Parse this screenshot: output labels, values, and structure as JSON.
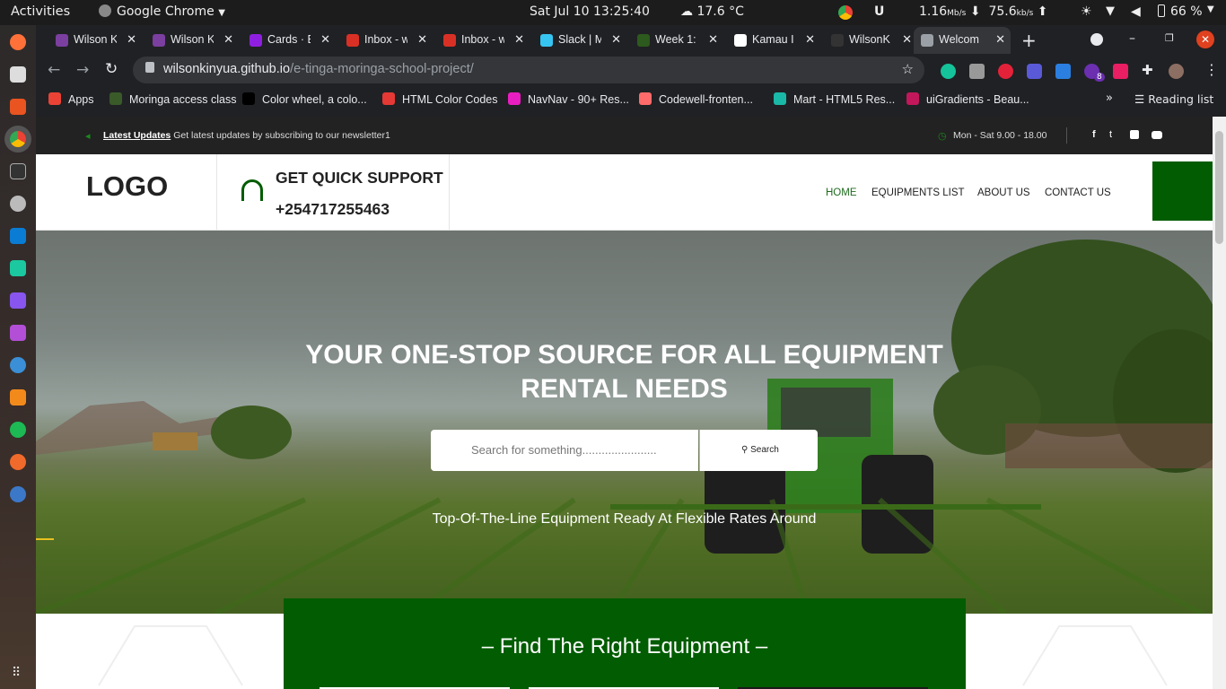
{
  "system": {
    "activities": "Activities",
    "app_menu": "Google Chrome",
    "datetime": "Sat Jul 10  13:25:40",
    "weather": "17.6 °C",
    "net_down": "1.16",
    "net_down_unit": "Mb/s",
    "net_up": "75.6",
    "net_up_unit": "kb/s",
    "battery": "66 %"
  },
  "tabs": [
    {
      "title": "Wilson K",
      "color": "#7b3fa0"
    },
    {
      "title": "Wilson K",
      "color": "#7b3fa0"
    },
    {
      "title": "Cards · B",
      "color": "#8e1fe0"
    },
    {
      "title": "Inbox - w",
      "color": "#d93025"
    },
    {
      "title": "Inbox - w",
      "color": "#d93025"
    },
    {
      "title": "Slack | M",
      "color": "#36c5f0"
    },
    {
      "title": "Week 1:",
      "color": "#2d5a1d"
    },
    {
      "title": "Kamau I",
      "color": "#ffffff"
    },
    {
      "title": "WilsonK",
      "color": "#333333"
    },
    {
      "title": "Welcom",
      "color": "#9aa0a6"
    }
  ],
  "omnibox": {
    "host": "wilsonkinyua.github.io",
    "path": "/e-tinga-moringa-school-project/"
  },
  "bookmarks": [
    {
      "label": "Apps",
      "color": "#ea4335"
    },
    {
      "label": "Moringa access class",
      "color": "#3a5a2a"
    },
    {
      "label": "Color wheel, a colo...",
      "color": "#000000"
    },
    {
      "label": "HTML Color Codes",
      "color": "#e53935"
    },
    {
      "label": "NavNav - 90+ Res...",
      "color": "#e91ec0"
    },
    {
      "label": "Codewell-fronten...",
      "color": "#ff6b6b"
    },
    {
      "label": "Mart - HTML5 Res...",
      "color": "#1ab8a6"
    },
    {
      "label": "uiGradients - Beau...",
      "color": "#c2185b"
    }
  ],
  "reading_list": "Reading list",
  "ext_badge": "8",
  "site": {
    "strip": {
      "updates_label": "Latest Updates",
      "updates_text": "Get latest updates by subscribing to our newsletter1",
      "hours": "Mon - Sat 9.00 - 18.00"
    },
    "logo": "LOGO",
    "support": {
      "title": "GET QUICK SUPPORT",
      "phone": "+254717255463"
    },
    "nav": [
      "HOME",
      "EQUIPMENTS LIST",
      "ABOUT US",
      "CONTACT US"
    ],
    "hero": {
      "title_line1": "YOUR ONE-STOP SOURCE FOR ALL EQUIPMENT",
      "title_line2": "RENTAL NEEDS",
      "search_placeholder": "Search for something.......................",
      "search_button": "Search",
      "subtitle": "Top-Of-The-Line Equipment Ready At Flexible Rates Around"
    },
    "find": {
      "title": "Find The Right Equipment"
    }
  },
  "colors": {
    "brand_green": "#025c02",
    "nav_active": "#1f6b1f"
  }
}
